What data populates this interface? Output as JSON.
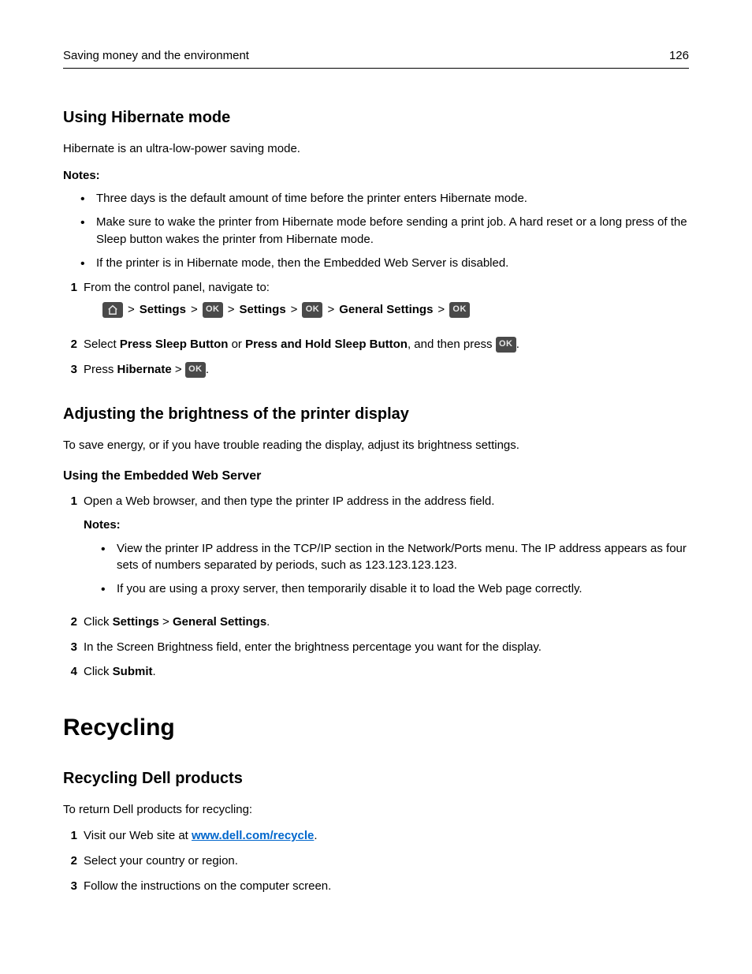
{
  "header": {
    "chapter": "Saving money and the environment",
    "page": "126"
  },
  "section1": {
    "title": "Using Hibernate mode",
    "intro": "Hibernate is an ultra-low-power saving mode.",
    "notes_label": "Notes:",
    "notes": [
      "Three days is the default amount of time before the printer enters Hibernate mode.",
      "Make sure to wake the printer from Hibernate mode before sending a print job. A hard reset or a long press of the Sleep button wakes the printer from Hibernate mode.",
      "If the printer is in Hibernate mode, then the Embedded Web Server is disabled."
    ],
    "step1_num": "1",
    "step1_text": "From the control panel, navigate to:",
    "nav_settings1": "Settings",
    "nav_settings2": "Settings",
    "nav_general": "General Settings",
    "step2_num": "2",
    "step2_pre": "Select ",
    "step2_b1": "Press Sleep Button",
    "step2_mid": " or ",
    "step2_b2": "Press and Hold Sleep Button",
    "step2_post": ", and then press ",
    "step3_num": "3",
    "step3_pre": "Press ",
    "step3_b": "Hibernate",
    "step3_sep": " > ",
    "ok_label": "OK",
    "sep": ">"
  },
  "section2": {
    "title": "Adjusting the brightness of the printer display",
    "intro": "To save energy, or if you have trouble reading the display, adjust its brightness settings.",
    "sub": "Using the Embedded Web Server",
    "step1_num": "1",
    "step1_text": "Open a Web browser, and then type the printer IP address in the address field.",
    "notes_label": "Notes:",
    "notes": [
      "View the printer IP address in the TCP/IP section in the Network/Ports menu. The IP address appears as four sets of numbers separated by periods, such as 123.123.123.123.",
      "If you are using a proxy server, then temporarily disable it to load the Web page correctly."
    ],
    "step2_num": "2",
    "step2_pre": "Click ",
    "step2_b1": "Settings",
    "step2_sep": " > ",
    "step2_b2": "General Settings",
    "step2_post": ".",
    "step3_num": "3",
    "step3_text": "In the Screen Brightness field, enter the brightness percentage you want for the display.",
    "step4_num": "4",
    "step4_pre": "Click ",
    "step4_b": "Submit",
    "step4_post": "."
  },
  "section3": {
    "big_title": "Recycling",
    "title": "Recycling Dell products",
    "intro": "To return Dell products for recycling:",
    "step1_num": "1",
    "step1_pre": "Visit our Web site at ",
    "step1_link": "www.dell.com/recycle",
    "step1_post": ".",
    "step2_num": "2",
    "step2_text": "Select your country or region.",
    "step3_num": "3",
    "step3_text": "Follow the instructions on the computer screen."
  }
}
